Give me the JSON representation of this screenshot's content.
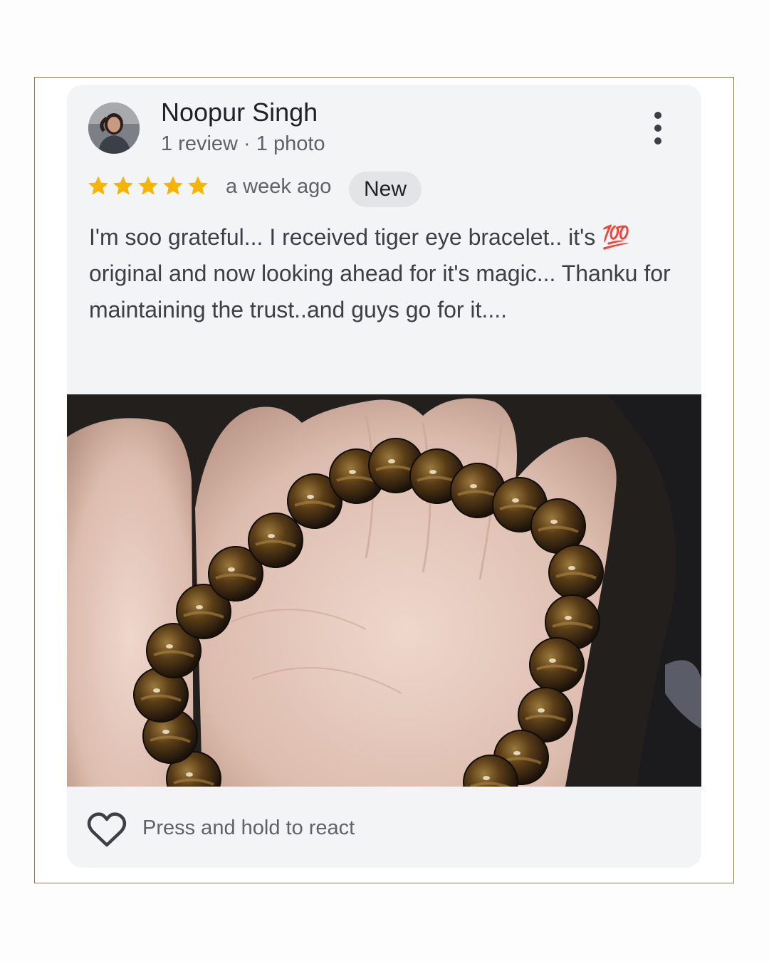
{
  "review": {
    "reviewer_name": "Noopur Singh",
    "reviewer_meta": "1 review · 1 photo",
    "rating": 5,
    "rating_max": 5,
    "star_color": "#f4b400",
    "time_ago": "a week ago",
    "badge": "New",
    "text": "I'm soo grateful... I received tiger eye bracelet.. it's 💯 original and now looking ahead for it's magic... Thanku for maintaining the trust..and guys go for it....",
    "more_icon": "more-vert-icon"
  },
  "footer": {
    "react_label": "Press and hold to react",
    "react_icon": "heart-outline-icon"
  }
}
